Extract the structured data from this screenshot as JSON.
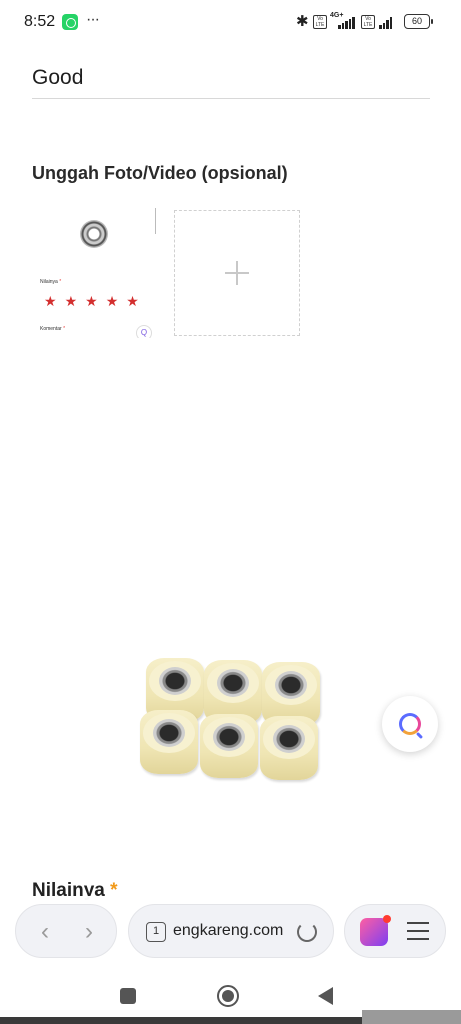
{
  "status_bar": {
    "time": "8:52",
    "dots": "···",
    "network_label": "4G+",
    "battery": "60"
  },
  "form": {
    "comment_value": "Good",
    "upload_title": "Unggah Foto/Video (opsional)",
    "rating_heading": "Nilainya",
    "required_mark": "*"
  },
  "uploaded_thumbnail": {
    "rating_label": "Nilainya",
    "comment_label": "Komentar",
    "required_mark": "*",
    "rating": "5 of 5 stars"
  },
  "browser": {
    "tab_count": "1",
    "url": "engkareng.com"
  },
  "colors": {
    "star": "#d32f2f",
    "required_accent": "#f29a1a",
    "whatsapp": "#25d366"
  },
  "icons": [
    "whatsapp-icon",
    "bluetooth-icon",
    "plus-icon",
    "search-ai-icon",
    "back-icon",
    "forward-icon",
    "reload-icon",
    "menu-icon",
    "home-icon",
    "recent-apps-icon"
  ]
}
